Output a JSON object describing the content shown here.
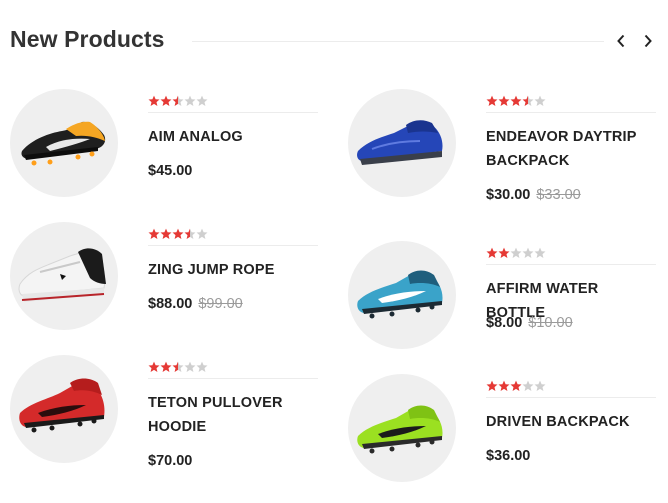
{
  "section": {
    "title": "New Products",
    "prev_icon": "chevron-left-icon",
    "next_icon": "chevron-right-icon"
  },
  "colors": {
    "star_filled": "#e53935",
    "star_empty": "#cfcfcf",
    "thumb_bg": "#efefef"
  },
  "products": [
    {
      "name": "AIM ANALOG",
      "price": "$45.00",
      "old_price": "",
      "rating": 2.5,
      "image": "black-orange-soccer-cleat"
    },
    {
      "name": "ZING JUMP ROPE",
      "price": "$88.00",
      "old_price": "$99.00",
      "rating": 3.5,
      "image": "white-black-basketball-shoe"
    },
    {
      "name": "TETON PULLOVER HOODIE",
      "price": "$70.00",
      "old_price": "",
      "rating": 2.5,
      "image": "red-soccer-cleat"
    },
    {
      "name": "ENDEAVOR DAYTRIP BACKPACK",
      "price": "$30.00",
      "old_price": "$33.00",
      "rating": 3.5,
      "image": "blue-running-shoe"
    },
    {
      "name": "AFFIRM WATER BOTTLE",
      "price": "$8.00",
      "old_price": "$10.00",
      "rating": 2,
      "image": "light-blue-soccer-cleat"
    },
    {
      "name": "DRIVEN BACKPACK",
      "price": "$36.00",
      "old_price": "",
      "rating": 3,
      "image": "green-soccer-cleat"
    }
  ]
}
